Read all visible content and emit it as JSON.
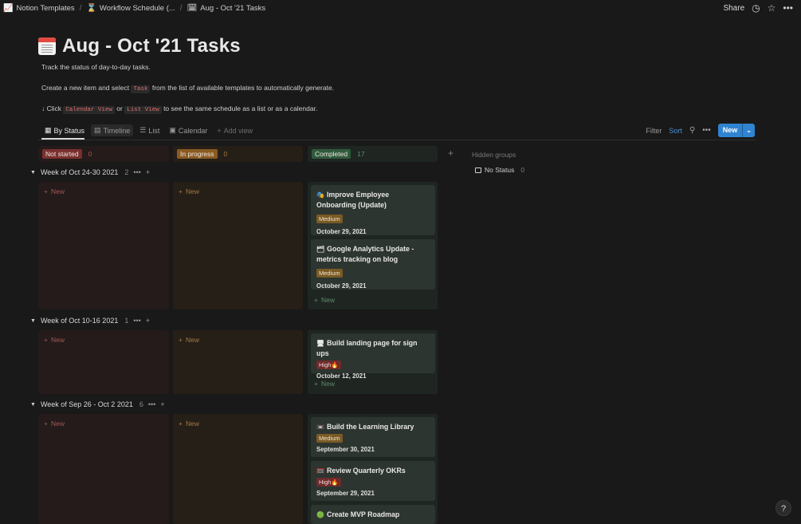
{
  "breadcrumb": [
    {
      "icon": "chart-icon",
      "label": "Notion Templates"
    },
    {
      "icon": "hourglass-icon",
      "label": "Workflow Schedule (..."
    },
    {
      "icon": "calendar-icon",
      "label": "Aug - Oct '21 Tasks"
    }
  ],
  "topbar": {
    "share_label": "Share",
    "history_icon": "clock-icon",
    "favorite_icon": "star-icon",
    "more_icon": "ellipsis-icon"
  },
  "page": {
    "title": "Aug - Oct '21 Tasks",
    "description_1": "Track the status of day-to-day tasks.",
    "description_2_pre": "Create a new item and select ",
    "description_2_code": "Task",
    "description_2_post": " from the list of available templates to automatically generate.",
    "description_3_pre": "↓ Click ",
    "description_3_code1": "Calendar View",
    "description_3_mid": " or ",
    "description_3_code2": "List View",
    "description_3_post": " to see the same schedule as a list or as a calendar."
  },
  "views": [
    {
      "label": "By Status",
      "icon": "board-icon"
    },
    {
      "label": "Timeline",
      "icon": "timeline-icon"
    },
    {
      "label": "List",
      "icon": "list-icon"
    },
    {
      "label": "Calendar",
      "icon": "calendar-icon"
    },
    {
      "label": "Add view",
      "icon": "plus-icon"
    }
  ],
  "toolbar": {
    "filter": "Filter",
    "sort": "Sort",
    "new": "New"
  },
  "columns": [
    {
      "label": "Not started",
      "count": "0",
      "pill_color": "#7a2f2f",
      "count_color": "#a05a55",
      "bg": "#241b1a"
    },
    {
      "label": "In progress",
      "count": "0",
      "pill_color": "#8a5a22",
      "count_color": "#a07a45",
      "bg": "#261f17"
    },
    {
      "label": "Completed",
      "count": "17",
      "pill_color": "#2f5a3c",
      "count_color": "#5e8a68",
      "bg": "#1f2622"
    }
  ],
  "hidden_groups": {
    "title": "Hidden groups",
    "items": [
      {
        "label": "No Status",
        "count": "0"
      }
    ]
  },
  "new_label": "New",
  "groups": [
    {
      "label": "Week of Oct 24-30 2021",
      "count": "2",
      "cards": [
        {
          "emoji": "🎭",
          "title": "Improve Employee Onboarding (Update)",
          "priority": "Medium",
          "date": "October 29, 2021"
        },
        {
          "emoji": "🗂",
          "title": "Google Analytics Update - metrics tracking on blog",
          "priority": "Medium",
          "date": "October 29, 2021"
        }
      ]
    },
    {
      "label": "Week of Oct 10-16 2021",
      "count": "1",
      "cards": [
        {
          "emoji": "🖥",
          "title": "Build landing page for sign ups",
          "priority": "High🔥",
          "date": "October 12, 2021"
        }
      ]
    },
    {
      "label": "Week of Sep 26 - Oct 2 2021",
      "count": "6",
      "cards": [
        {
          "emoji": "📼",
          "title": "Build the Learning Library",
          "priority": "Medium",
          "date": "September 30, 2021"
        },
        {
          "emoji": "🥅",
          "title": "Review Quarterly OKRs",
          "priority": "High🔥",
          "date": "September 29, 2021"
        },
        {
          "emoji": "🟢",
          "title": "Create MVP Roadmap",
          "priority": "",
          "date": ""
        }
      ]
    }
  ],
  "help_label": "?"
}
